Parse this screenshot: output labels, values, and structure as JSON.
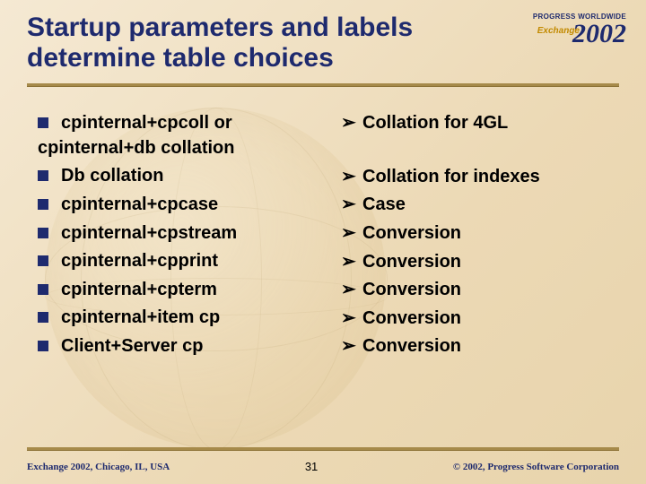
{
  "logo": {
    "tagline": "PROGRESS WORLDWIDE",
    "exchange": "Exchange",
    "year": "2002"
  },
  "title": "Startup parameters and labels determine table choices",
  "left": [
    {
      "text": "cpinternal+cpcoll or",
      "cont": "cpinternal+db collation"
    },
    {
      "text": "Db collation"
    },
    {
      "text": "cpinternal+cpcase"
    },
    {
      "text": "cpinternal+cpstream"
    },
    {
      "text": "cpinternal+cpprint"
    },
    {
      "text": "cpinternal+cpterm"
    },
    {
      "text": "cpinternal+item cp"
    },
    {
      "text": "Client+Server cp"
    }
  ],
  "right": [
    "Collation for 4GL",
    "Collation for indexes",
    "Case",
    "Conversion",
    "Conversion",
    "Conversion",
    "Conversion",
    "Conversion"
  ],
  "footer": {
    "left": "Exchange 2002, Chicago, IL, USA",
    "page": "31",
    "right": "© 2002, Progress Software Corporation"
  }
}
